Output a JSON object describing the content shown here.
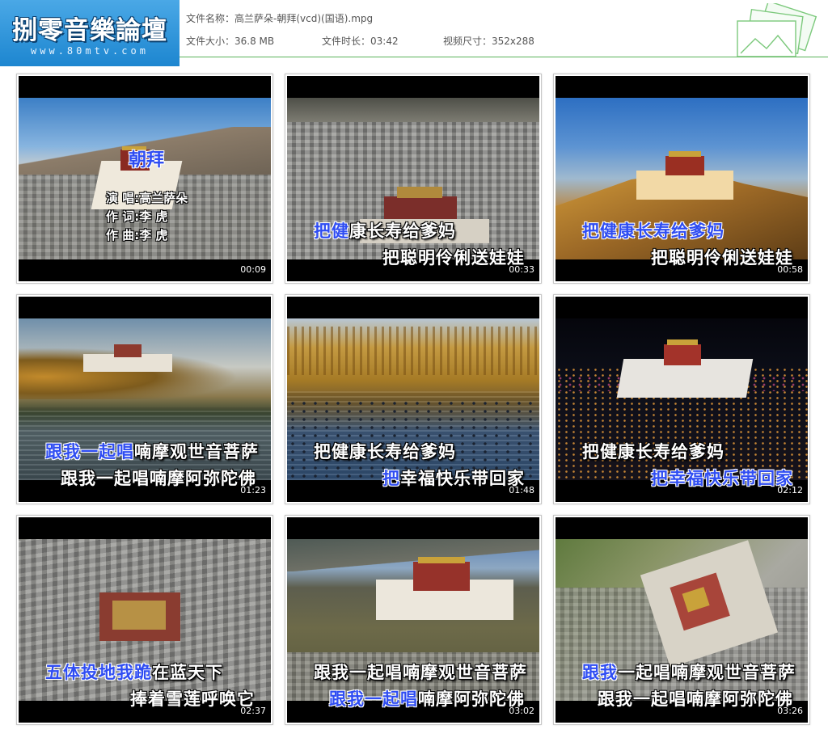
{
  "logo": {
    "title": "捌零音樂論壇",
    "url": "www.80mtv.com"
  },
  "file": {
    "name_label": "文件名称：",
    "name": "高兰萨朵-朝拜(vcd)(国语).mpg",
    "size_label": "文件大小：",
    "size": "36.8 MB",
    "duration_label": "文件时长：",
    "duration": "03:42",
    "dimensions_label": "视频尺寸：",
    "dimensions": "352x288"
  },
  "accent_colors": {
    "logo_blue": "#2a90d8",
    "header_line": "#5ab35a",
    "lyric_highlight": "#2f4df2"
  },
  "thumbnails": [
    {
      "timestamp": "00:09",
      "title": "朝拜",
      "credits": [
        "演 唱:高兰萨朵",
        "作 词:李  虎",
        "作 曲:李  虎"
      ]
    },
    {
      "timestamp": "00:33",
      "line1": {
        "hl": "把健",
        "rest": "康长寿给爹妈"
      },
      "line2": {
        "hl": "",
        "rest": "把聪明伶俐送娃娃"
      }
    },
    {
      "timestamp": "00:58",
      "line1": {
        "hl": "把健康长寿给爹妈",
        "rest": ""
      },
      "line2": {
        "hl": "",
        "rest": "把聪明伶俐送娃娃"
      }
    },
    {
      "timestamp": "01:23",
      "line1": {
        "hl": "跟我一起唱",
        "rest": "喃摩观世音菩萨"
      },
      "line2": {
        "hl": "",
        "rest": "跟我一起唱喃摩阿弥陀佛"
      }
    },
    {
      "timestamp": "01:48",
      "line1": {
        "hl": "",
        "rest": "把健康长寿给爹妈"
      },
      "line2": {
        "hl": "把",
        "rest": "幸福快乐带回家"
      }
    },
    {
      "timestamp": "02:12",
      "line1": {
        "hl": "",
        "rest": "把健康长寿给爹妈"
      },
      "line2": {
        "hl": "把幸福快乐带回家",
        "rest": ""
      }
    },
    {
      "timestamp": "02:37",
      "line1": {
        "hl": "五体投地我跪",
        "rest": "在蓝天下"
      },
      "line2": {
        "hl": "",
        "rest": "捧着雪莲呼唤它"
      }
    },
    {
      "timestamp": "03:02",
      "line1": {
        "hl": "",
        "rest": "跟我一起唱喃摩观世音菩萨"
      },
      "line2": {
        "hl": "跟我一起唱",
        "rest": "喃摩阿弥陀佛"
      }
    },
    {
      "timestamp": "03:26",
      "line1": {
        "hl": "跟我",
        "rest": "一起唱喃摩观世音菩萨"
      },
      "line2": {
        "hl": "",
        "rest": "跟我一起唱喃摩阿弥陀佛"
      }
    }
  ]
}
